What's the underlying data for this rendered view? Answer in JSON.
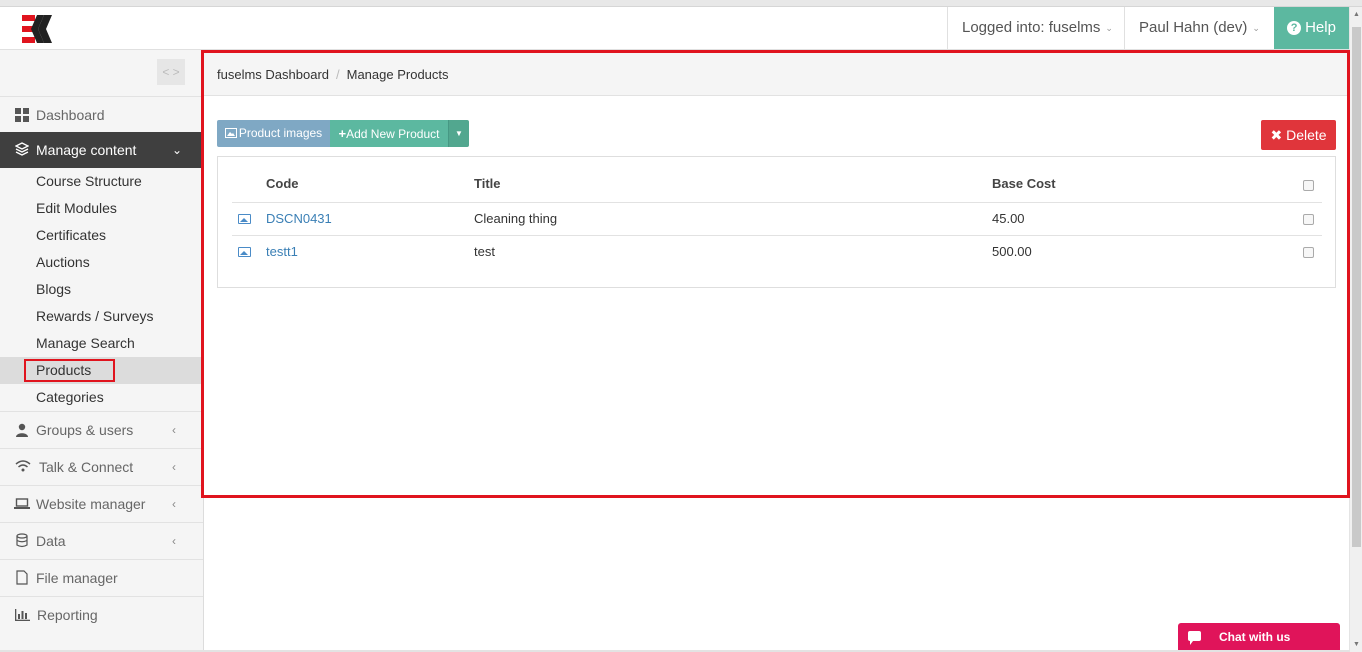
{
  "header": {
    "logged_into": "Logged into: fuselms",
    "user": "Paul Hahn (dev)",
    "help": "Help"
  },
  "sidebar": {
    "collapse": "< >",
    "items": [
      {
        "label": "Dashboard",
        "icon": "dashboard-grid-icon"
      },
      {
        "label": "Manage content",
        "icon": "layers-icon"
      },
      {
        "label": "Groups & users",
        "icon": "user-icon"
      },
      {
        "label": "Talk & Connect",
        "icon": "wifi-icon"
      },
      {
        "label": "Website manager",
        "icon": "laptop-icon"
      },
      {
        "label": "Data",
        "icon": "database-icon"
      },
      {
        "label": "File manager",
        "icon": "file-icon"
      },
      {
        "label": "Reporting",
        "icon": "bar-chart-icon"
      }
    ],
    "sub_items": [
      "Course Structure",
      "Edit Modules",
      "Certificates",
      "Auctions",
      "Blogs",
      "Rewards / Surveys",
      "Manage Search",
      "Products",
      "Categories"
    ]
  },
  "breadcrumb": {
    "home": "fuselms Dashboard",
    "current": "Manage Products"
  },
  "toolbar": {
    "product_images": "Product images",
    "add_new": "Add New Product",
    "delete": "Delete"
  },
  "table": {
    "headers": [
      "Code",
      "Title",
      "Base Cost"
    ],
    "rows": [
      {
        "code": "DSCN0431",
        "title": "Cleaning thing",
        "base_cost": "45.00"
      },
      {
        "code": "testt1",
        "title": "test",
        "base_cost": "500.00"
      }
    ]
  },
  "chat": {
    "label": "Chat with us"
  },
  "colors": {
    "highlight": "#e0141e",
    "accent": "#5cb8a0",
    "delete": "#e0353b",
    "chat": "#e0145a"
  }
}
